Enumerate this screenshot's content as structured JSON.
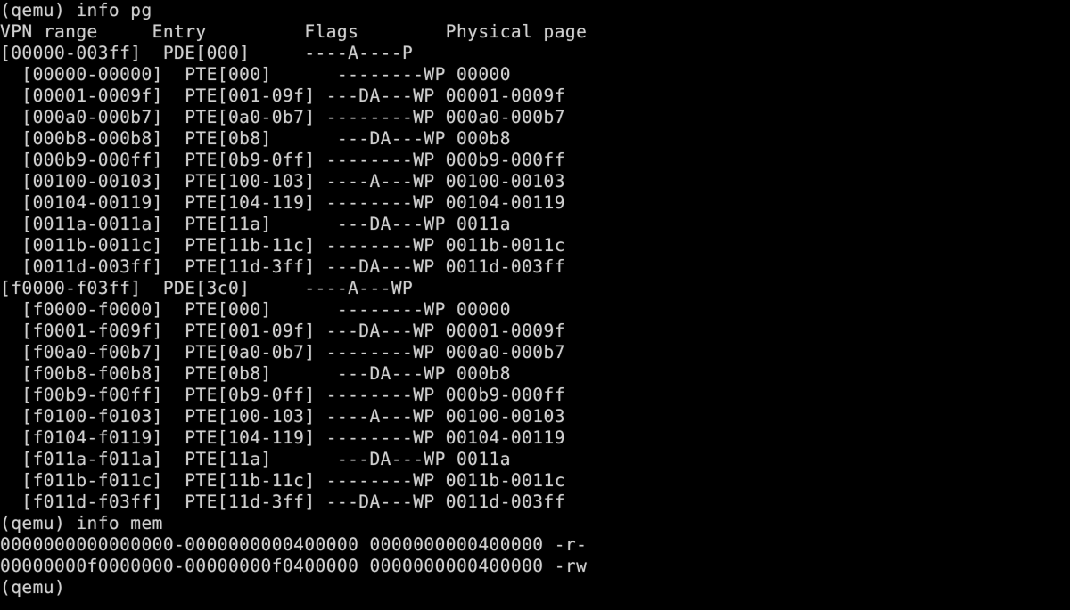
{
  "colors": {
    "background": "#000000",
    "foreground": "#cfcfcf"
  },
  "terminal": {
    "lines": [
      "(qemu) info pg",
      "VPN range     Entry         Flags        Physical page",
      "[00000-003ff]  PDE[000]     ----A----P",
      "  [00000-00000]  PTE[000]      --------WP 00000",
      "  [00001-0009f]  PTE[001-09f] ---DA---WP 00001-0009f",
      "  [000a0-000b7]  PTE[0a0-0b7] --------WP 000a0-000b7",
      "  [000b8-000b8]  PTE[0b8]      ---DA---WP 000b8",
      "  [000b9-000ff]  PTE[0b9-0ff] --------WP 000b9-000ff",
      "  [00100-00103]  PTE[100-103] ----A---WP 00100-00103",
      "  [00104-00119]  PTE[104-119] --------WP 00104-00119",
      "  [0011a-0011a]  PTE[11a]      ---DA---WP 0011a",
      "  [0011b-0011c]  PTE[11b-11c] --------WP 0011b-0011c",
      "  [0011d-003ff]  PTE[11d-3ff] ---DA---WP 0011d-003ff",
      "[f0000-f03ff]  PDE[3c0]     ----A---WP",
      "  [f0000-f0000]  PTE[000]      --------WP 00000",
      "  [f0001-f009f]  PTE[001-09f] ---DA---WP 00001-0009f",
      "  [f00a0-f00b7]  PTE[0a0-0b7] --------WP 000a0-000b7",
      "  [f00b8-f00b8]  PTE[0b8]      ---DA---WP 000b8",
      "  [f00b9-f00ff]  PTE[0b9-0ff] --------WP 000b9-000ff",
      "  [f0100-f0103]  PTE[100-103] ----A---WP 00100-00103",
      "  [f0104-f0119]  PTE[104-119] --------WP 00104-00119",
      "  [f011a-f011a]  PTE[11a]      ---DA---WP 0011a",
      "  [f011b-f011c]  PTE[11b-11c] --------WP 0011b-0011c",
      "  [f011d-f03ff]  PTE[11d-3ff] ---DA---WP 0011d-003ff",
      "(qemu) info mem",
      "0000000000000000-0000000000400000 0000000000400000 -r-",
      "00000000f0000000-00000000f0400000 0000000000400000 -rw",
      "(qemu)"
    ]
  }
}
